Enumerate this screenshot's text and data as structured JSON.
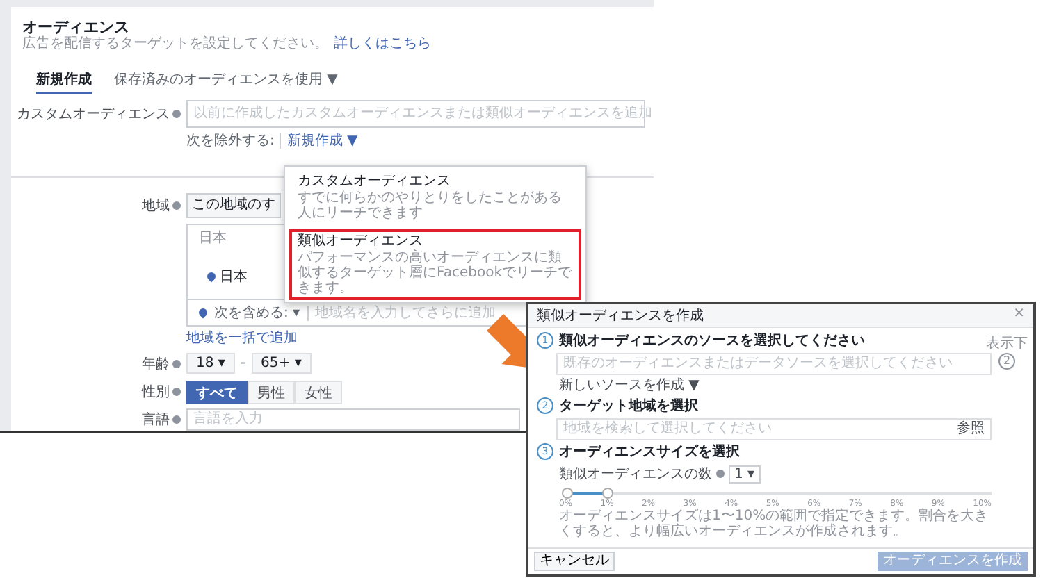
{
  "audience": {
    "title": "オーディエンス",
    "subtitle": "広告を配信するターゲットを設定してください。",
    "learn_more": "詳しくはこちら",
    "tabs": [
      {
        "label": "新規作成",
        "selected": true
      },
      {
        "label": "保存済みのオーディエンスを使用 ▼",
        "selected": false
      }
    ],
    "custom_audience": {
      "label": "カスタムオーディエンス",
      "placeholder": "以前に作成したカスタムオーディエンスまたは類似オーディエンスを追加",
      "exclude": "次を除外する:",
      "create_new": "新規作成 ▼"
    },
    "region": {
      "label": "地域",
      "select": "この地域のす",
      "box_header": "日本",
      "chip": "日本",
      "include": "次を含める: ▾",
      "placeholder": "地域名を入力してさらに追加",
      "bulk_link": "地域を一括で追加"
    },
    "age": {
      "label": "年齢",
      "min": "18 ▾",
      "sep": "-",
      "max": "65+ ▾"
    },
    "gender": {
      "label": "性別",
      "options": [
        {
          "label": "すべて",
          "selected": true
        },
        {
          "label": "男性",
          "selected": false
        },
        {
          "label": "女性",
          "selected": false
        }
      ]
    },
    "language": {
      "label": "言語",
      "placeholder": "言語を入力"
    }
  },
  "create_menu": [
    {
      "title": "カスタムオーディエンス",
      "description": "すでに何らかのやりとりをしたことがある人にリーチできます",
      "highlighted": false
    },
    {
      "title": "類似オーディエンス",
      "description": "パフォーマンスの高いオーディエンスに類似するターゲット層にFacebookでリーチできます。",
      "highlighted": true
    }
  ],
  "dialog": {
    "title": "類似オーディエンスを作成",
    "close": "×",
    "side_note": "表示下",
    "side_count": "2",
    "steps": [
      {
        "number": "1",
        "title": "類似オーディエンスのソースを選択してください",
        "kind": "source",
        "placeholder": "既存のオーディエンスまたはデータソースを選択してください",
        "link": "新しいソースを作成 ▼"
      },
      {
        "number": "2",
        "title": "ターゲット地域を選択",
        "kind": "region",
        "placeholder": "地域を検索して選択してください",
        "button": "参照"
      },
      {
        "number": "3",
        "title": "オーディエンスサイズを選択",
        "kind": "size",
        "count_label": "類似オーディエンスの数",
        "count": "1 ▾",
        "level": 0.1,
        "ticks": [
          "0%",
          "1%",
          "2%",
          "3%",
          "4%",
          "5%",
          "6%",
          "7%",
          "8%",
          "9%",
          "10%"
        ],
        "description": "オーディエンスサイズは1〜10%の範囲で指定できます。割合を大きくすると、より幅広いオーディエンスが作成されます。"
      }
    ],
    "cancel": "キャンセル",
    "submit": "オーディエンスを作成"
  }
}
